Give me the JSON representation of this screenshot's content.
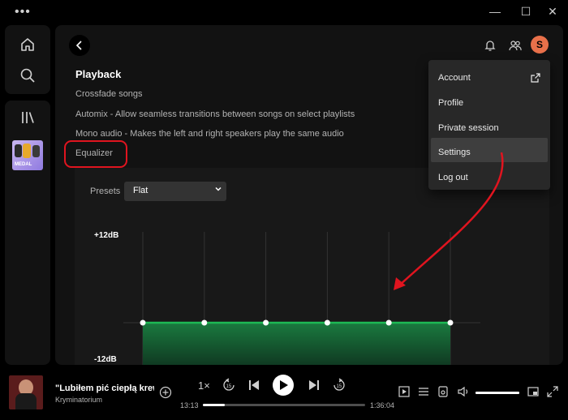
{
  "titlebar": {
    "menu_dots": "•••",
    "minimize": "—",
    "maximize": "☐",
    "close": "✕"
  },
  "sidebar": {
    "items": [
      {
        "icon": "home-icon"
      },
      {
        "icon": "search-icon"
      },
      {
        "icon": "library-icon"
      }
    ],
    "playlist_cover_text": "MEDAL"
  },
  "header": {
    "avatar_letter": "S",
    "icons": [
      "back-arrow-icon",
      "bell-icon",
      "friends-icon"
    ]
  },
  "settings": {
    "section_title": "Playback",
    "lines": [
      "Crossfade songs",
      "Automix - Allow seamless transitions between songs on select playlists",
      "Mono audio - Makes the left and right speakers play the same audio",
      "Equalizer"
    ],
    "presets_label": "Presets",
    "preset_value": "Flat",
    "db_top": "+12dB",
    "db_bottom": "-12dB"
  },
  "eq": {
    "band_gains_db": [
      0,
      0,
      0,
      0,
      0,
      0
    ],
    "accent_color": "#1db954"
  },
  "profile_menu": {
    "items": [
      "Account",
      "Profile",
      "Private session",
      "Settings",
      "Log out"
    ],
    "highlighted": "Settings"
  },
  "annotation": {
    "color": "#e0141f"
  },
  "player": {
    "track_title": "\"Lubiłem pić ciepłą krew",
    "artist": "Kryminatorium",
    "speed": "1×",
    "time_elapsed": "13:13",
    "time_total": "1:36:04",
    "progress_fraction": 0.137,
    "volume_fraction": 1.0
  }
}
